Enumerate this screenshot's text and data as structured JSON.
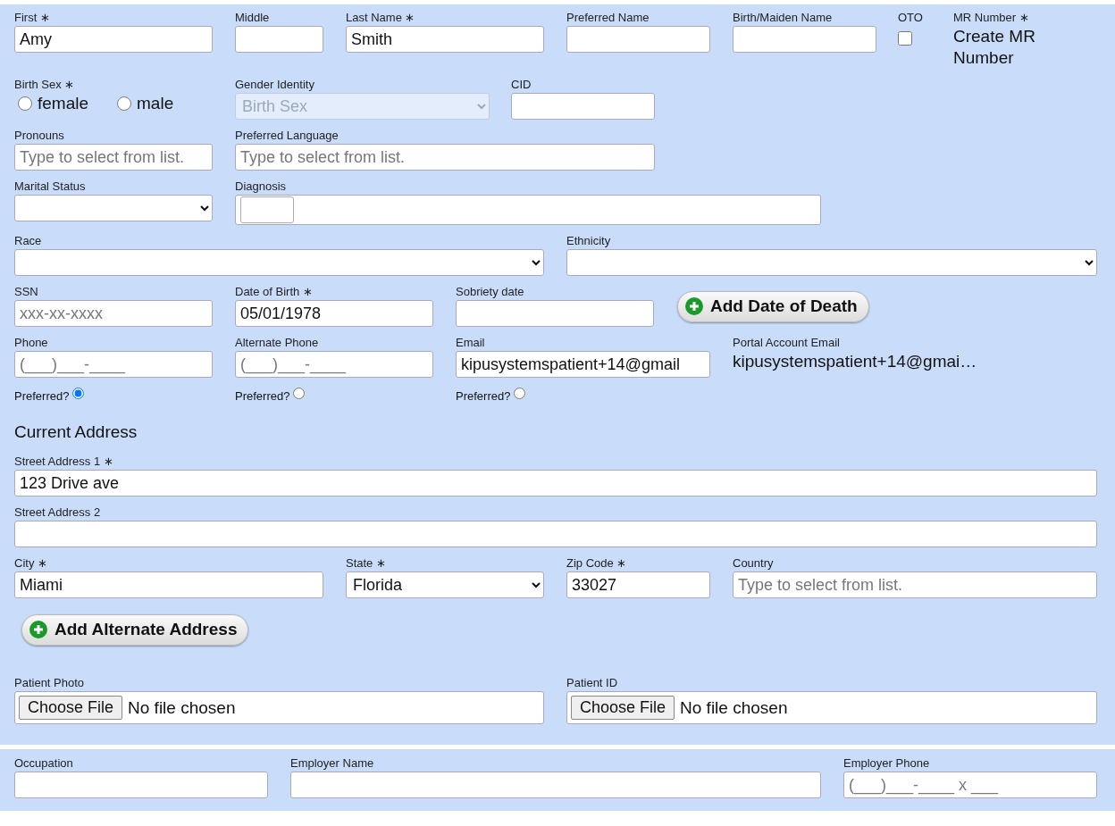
{
  "panels": [
    {
      "blocks": [
        {
          "kind": "row",
          "fields": [
            {
              "kind": "text",
              "label": "First ∗",
              "value": "Amy"
            },
            {
              "kind": "text",
              "label": "Middle"
            },
            {
              "kind": "text",
              "label": "Last Name ∗",
              "value": "Smith"
            },
            {
              "kind": "text",
              "label": "Preferred Name"
            },
            {
              "kind": "text",
              "label": "Birth/Maiden Name"
            },
            {
              "kind": "checkbox",
              "label": "OTO",
              "checked": false
            },
            {
              "kind": "static",
              "label": "MR Number ∗",
              "text": "Create MR Number"
            }
          ]
        },
        {
          "kind": "row",
          "fields": [
            {
              "kind": "radios",
              "label": "Birth Sex ∗",
              "options": [
                {
                  "label": "female",
                  "selected": false
                },
                {
                  "label": "male",
                  "selected": false
                }
              ]
            },
            {
              "kind": "select",
              "label": "Gender Identity",
              "value": "Birth Sex",
              "disabled": true
            },
            {
              "kind": "text",
              "label": "CID"
            }
          ]
        },
        {
          "kind": "row",
          "fields": [
            {
              "kind": "text",
              "label": "Pronouns",
              "placeholder": "Type to select from list."
            },
            {
              "kind": "text",
              "label": "Preferred Language",
              "placeholder": "Type to select from list."
            }
          ]
        },
        {
          "kind": "row",
          "fields": [
            {
              "kind": "select",
              "label": "Marital Status",
              "disabled": false
            },
            {
              "kind": "picker",
              "label": "Diagnosis"
            }
          ]
        },
        {
          "kind": "row",
          "fields": [
            {
              "kind": "select",
              "label": "Race",
              "disabled": false
            },
            {
              "kind": "select",
              "label": "Ethnicity",
              "disabled": false
            }
          ]
        },
        {
          "kind": "row",
          "fields": [
            {
              "kind": "text",
              "label": "SSN",
              "placeholder": "xxx-xx-xxxx"
            },
            {
              "kind": "text",
              "label": "Date of Birth ∗",
              "value": "05/01/1978"
            },
            {
              "kind": "text",
              "label": "Sobriety date"
            },
            {
              "kind": "button",
              "label": "Add Date of Death"
            }
          ]
        },
        {
          "kind": "row",
          "fields": [
            {
              "kind": "text",
              "label": "Phone",
              "placeholder": "(___)___-____",
              "preferred": {
                "label": "Preferred?",
                "selected": true
              }
            },
            {
              "kind": "text",
              "label": "Alternate Phone",
              "placeholder": "(___)___-____",
              "preferred": {
                "label": "Preferred?",
                "selected": false
              }
            },
            {
              "kind": "text",
              "label": "Email",
              "value": "kipusystemspatient+14@gmail",
              "preferred": {
                "label": "Preferred?",
                "selected": false
              }
            },
            {
              "kind": "static",
              "label": "Portal Account Email",
              "text": "kipusystemspatient+14@gmai…"
            }
          ]
        },
        {
          "kind": "heading",
          "text": "Current Address"
        },
        {
          "kind": "row",
          "fields": [
            {
              "kind": "text",
              "label": "Street Address 1 ∗",
              "value": "123 Drive ave"
            }
          ]
        },
        {
          "kind": "row",
          "fields": [
            {
              "kind": "text",
              "label": "Street Address 2"
            }
          ]
        },
        {
          "kind": "row",
          "fields": [
            {
              "kind": "text",
              "label": "City ∗",
              "value": "Miami"
            },
            {
              "kind": "select",
              "label": "State ∗",
              "value": "Florida",
              "disabled": false
            },
            {
              "kind": "text",
              "label": "Zip Code ∗",
              "value": "33027"
            },
            {
              "kind": "text",
              "label": "Country",
              "placeholder": "Type to select from list."
            }
          ]
        },
        {
          "kind": "button",
          "label": "Add Alternate Address"
        },
        {
          "kind": "row",
          "fields": [
            {
              "kind": "file",
              "label": "Patient Photo",
              "button": "Choose File",
              "status": "No file chosen"
            },
            {
              "kind": "file",
              "label": "Patient ID",
              "button": "Choose File",
              "status": "No file chosen"
            }
          ]
        }
      ]
    },
    {
      "blocks": [
        {
          "kind": "row",
          "fields": [
            {
              "kind": "text",
              "label": "Occupation"
            },
            {
              "kind": "text",
              "label": "Employer Name"
            },
            {
              "kind": "text",
              "label": "Employer Phone",
              "placeholder": "(___)___-____ x ___"
            }
          ]
        }
      ]
    }
  ]
}
